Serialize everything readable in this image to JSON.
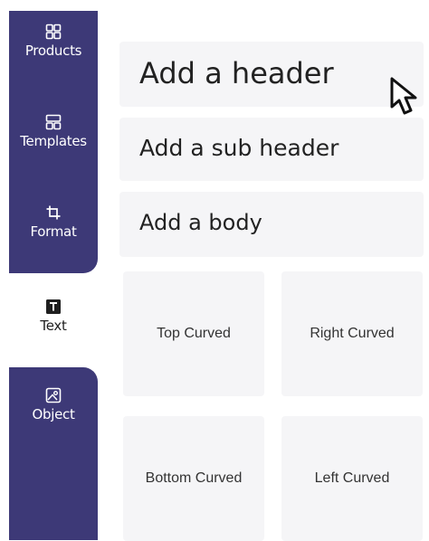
{
  "sidebar": {
    "items": [
      {
        "label": "Products",
        "icon": "products-grid-icon",
        "active": false
      },
      {
        "label": "Templates",
        "icon": "templates-layout-icon",
        "active": false
      },
      {
        "label": "Format",
        "icon": "crop-icon",
        "active": false
      },
      {
        "label": "Text",
        "icon": "text-icon",
        "active": true
      },
      {
        "label": "Object",
        "icon": "image-icon",
        "active": false
      }
    ],
    "accent_color": "#3d3977"
  },
  "text_panel": {
    "header_label": "Add a header",
    "subheader_label": "Add a sub header",
    "body_label": "Add a body"
  },
  "curved_styles": {
    "top": "Top Curved",
    "right": "Right Curved",
    "bottom": "Bottom Curved",
    "left": "Left Curved"
  }
}
